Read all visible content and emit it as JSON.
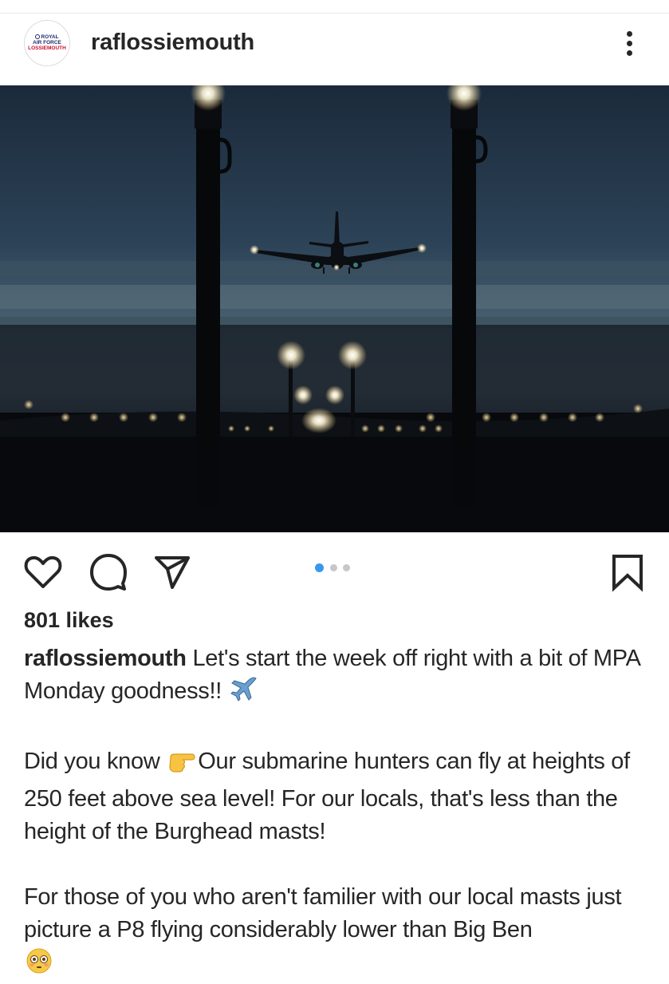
{
  "post": {
    "username": "raflossiemouth",
    "avatar": {
      "line1": "ROYAL",
      "line2": "AIR FORCE",
      "line3": "LOSSIEMOUTH"
    },
    "likes": "801 likes",
    "carousel": {
      "current": 1,
      "total": 3
    },
    "caption": {
      "username": "raflossiemouth",
      "paragraph1": "Let's start the week off right with a bit of MPA Monday goodness!!",
      "paragraph2_before_emoji": "Did you know",
      "paragraph2_after_emoji": "Our submarine hunters can fly at heights of 250 feet above sea level! For our locals, that's less than the height of the Burghead masts!",
      "paragraph3": "For those of you who aren't familier with our local masts just picture a P8 flying considerably lower than Big Ben"
    },
    "emojis": [
      "airplane-emoji",
      "pointing-right-emoji",
      "flushed-face-emoji"
    ]
  },
  "icons": {
    "more": "more-vertical-icon",
    "like": "heart-icon",
    "comment": "comment-icon",
    "share": "paper-plane-icon",
    "save": "bookmark-icon"
  },
  "colors": {
    "text": "#262626",
    "dot_active": "#3897f0",
    "dot_inactive": "#c7c7c7",
    "raf_blue": "#1f2a6b",
    "raf_red": "#c8102e"
  }
}
